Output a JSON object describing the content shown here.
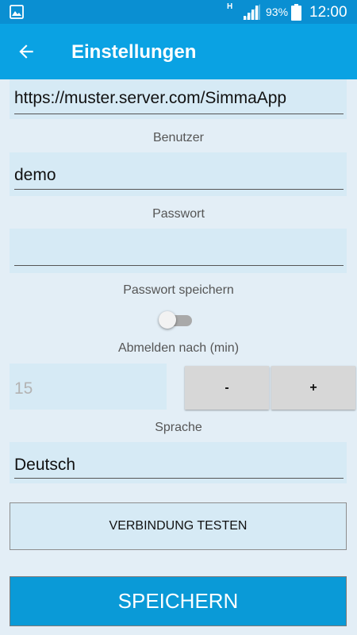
{
  "status_bar": {
    "network_type": "H",
    "battery_percent": "93%",
    "time": "12:00"
  },
  "app_bar": {
    "title": "Einstellungen"
  },
  "form": {
    "server_url": {
      "value": "https://muster.server.com/SimmaApp"
    },
    "user": {
      "label": "Benutzer",
      "value": "demo"
    },
    "password": {
      "label": "Passwort",
      "value": ""
    },
    "save_password": {
      "label": "Passwort speichern",
      "enabled": false
    },
    "logout_after": {
      "label": "Abmelden nach (min)",
      "value": "15",
      "decrement_label": "-",
      "increment_label": "+"
    },
    "language": {
      "label": "Sprache",
      "value": "Deutsch"
    }
  },
  "buttons": {
    "test_connection": "VERBINDUNG TESTEN",
    "save": "SPEICHERN"
  },
  "colors": {
    "status_bar": "#0a8fd2",
    "app_bar": "#0aa2e3",
    "background": "#e3eef6",
    "field": "#d6eaf5",
    "save_button": "#0a9ad7"
  }
}
